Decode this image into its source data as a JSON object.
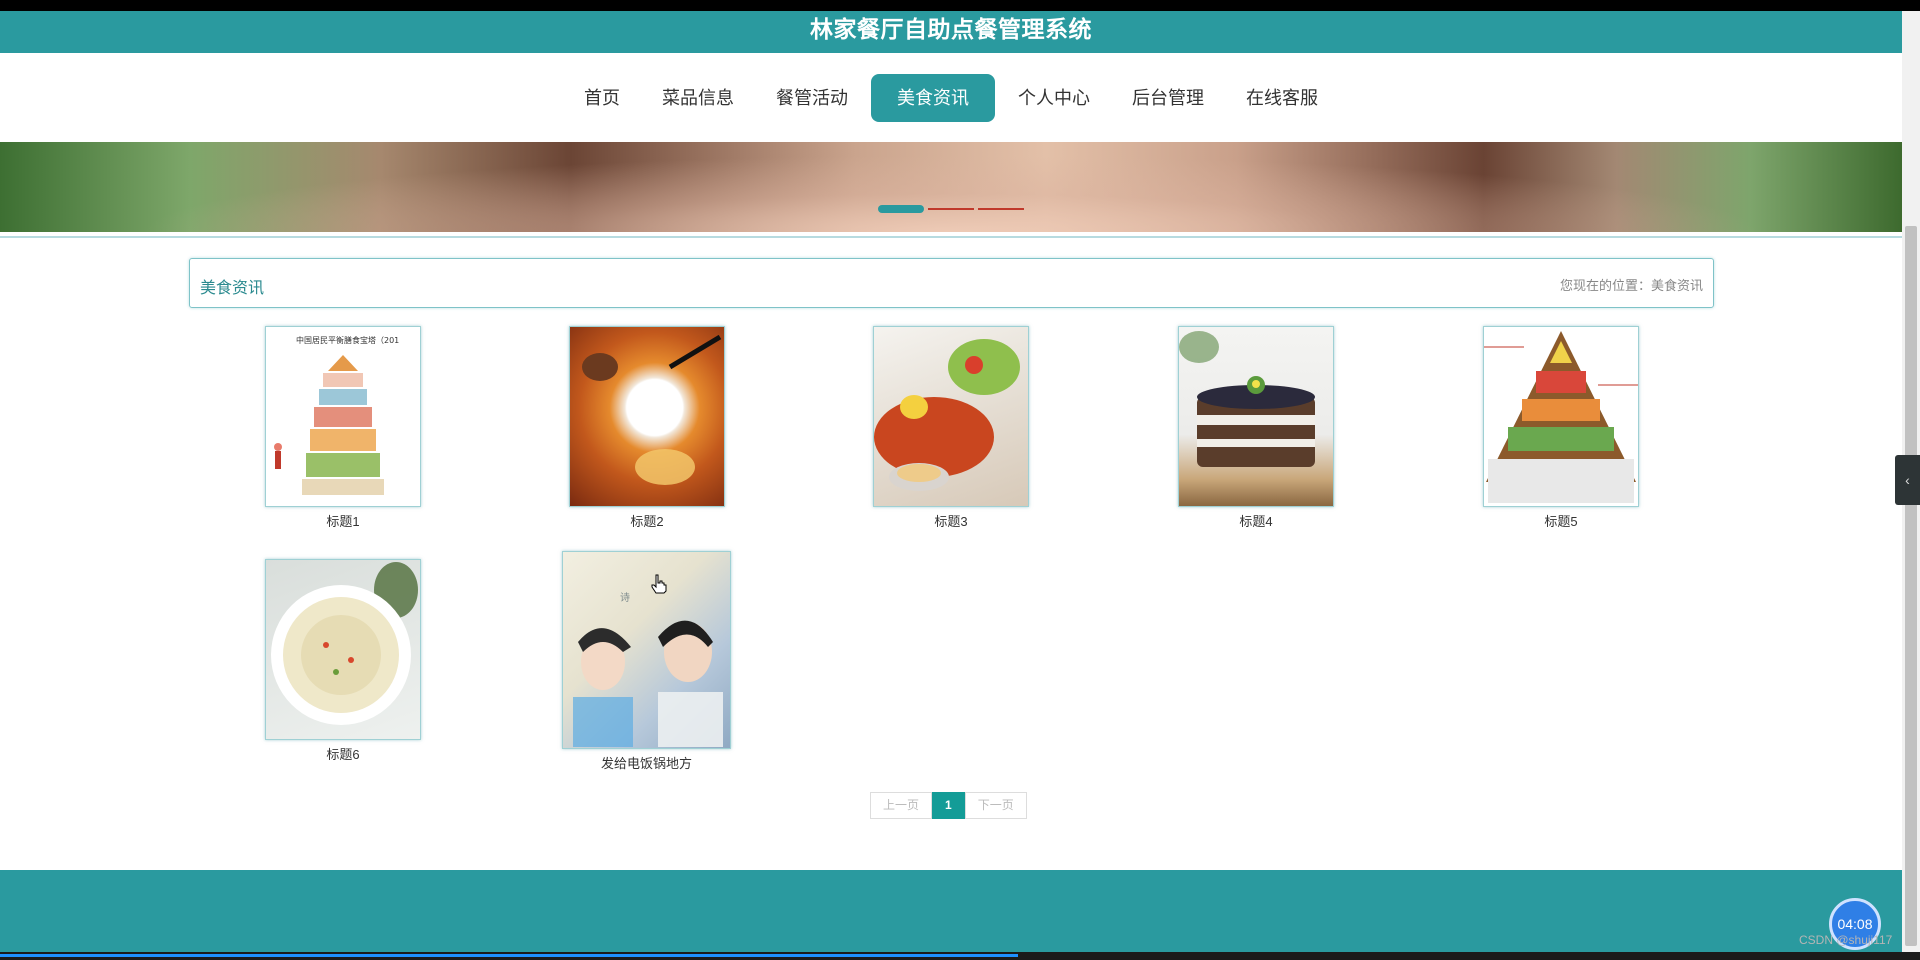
{
  "site_title": "林家餐厅自助点餐管理系统",
  "nav": [
    {
      "label": "首页",
      "active": false
    },
    {
      "label": "菜品信息",
      "active": false
    },
    {
      "label": "餐管活动",
      "active": false
    },
    {
      "label": "美食资讯",
      "active": true
    },
    {
      "label": "个人中心",
      "active": false
    },
    {
      "label": "后台管理",
      "active": false
    },
    {
      "label": "在线客服",
      "active": false
    }
  ],
  "banner": {
    "slides": 3,
    "active_slide": 1
  },
  "section": {
    "title": "美食资讯",
    "location": "您现在的位置：美食资讯"
  },
  "thumb_texts": {
    "pyramid_heading": "中国居民平衡膳食宝塔（201"
  },
  "articles": [
    {
      "title": "标题1",
      "image": "food-pyramid-chart"
    },
    {
      "title": "标题2",
      "image": "braised-abalone-rice"
    },
    {
      "title": "标题3",
      "image": "lobster-platter"
    },
    {
      "title": "标题4",
      "image": "berry-layer-cake"
    },
    {
      "title": "标题5",
      "image": "food-pyramid-triangle"
    },
    {
      "title": "标题6",
      "image": "congee-bowl"
    },
    {
      "title": "发给电饭锅地方",
      "image": "poster-illustration"
    }
  ],
  "pager": {
    "prev": "上一页",
    "current": "1",
    "next": "下一页"
  },
  "timer": "04:08",
  "watermark": "CSDN @shuji117",
  "colors": {
    "primary": "#2a9a9f",
    "pager_active": "#139c97"
  }
}
